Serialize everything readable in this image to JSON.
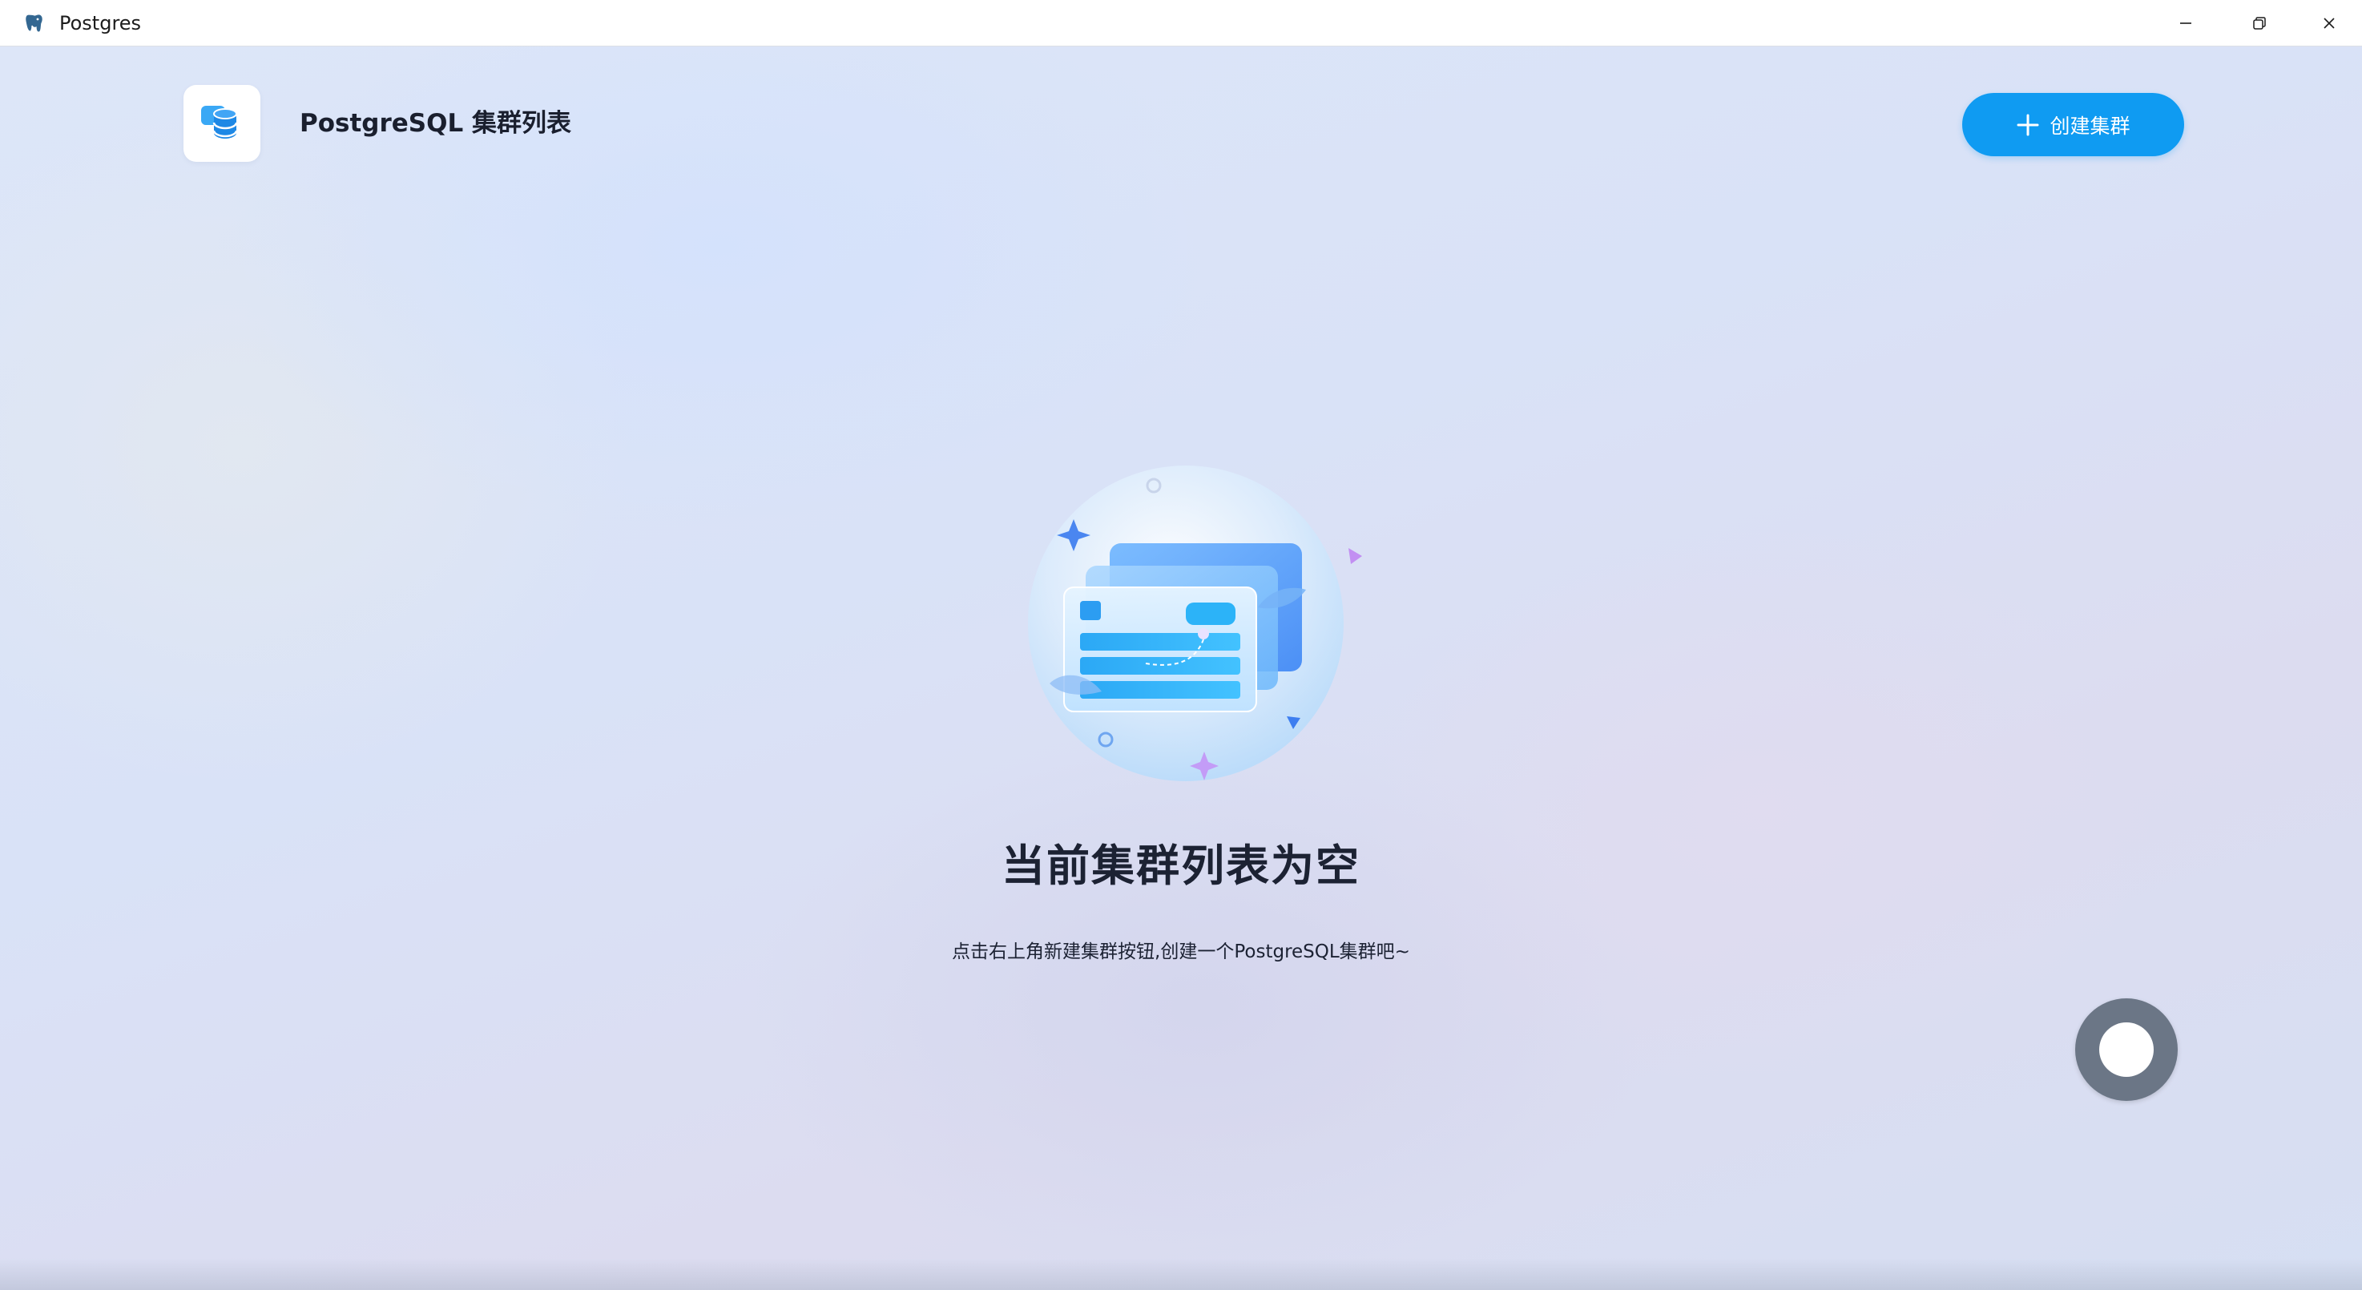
{
  "window": {
    "title": "Postgres"
  },
  "header": {
    "title": "PostgreSQL 集群列表",
    "create_button_label": "创建集群"
  },
  "empty_state": {
    "title": "当前集群列表为空",
    "description": "点击右上角新建集群按钮,创建一个PostgreSQL集群吧~"
  },
  "icons": {
    "app": "postgres-elephant-icon",
    "logo": "database-icon",
    "create": "plus-icon",
    "minimize": "minimize-icon",
    "maximize": "restore-icon",
    "close": "close-icon",
    "float": "assistive-touch-icon"
  },
  "colors": {
    "accent": "#0f9bf2",
    "title_text": "#1c2233",
    "float_button": "#6b7686"
  }
}
